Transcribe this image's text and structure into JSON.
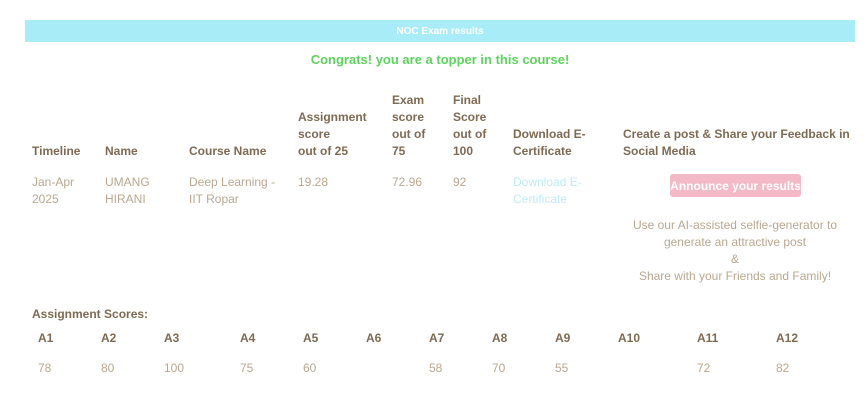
{
  "banner": {
    "title": "NOC Exam results"
  },
  "congrats": "Congrats! you are a topper in this course!",
  "table": {
    "headers": {
      "timeline": "Timeline",
      "name": "Name",
      "course": "Course Name",
      "assignment": [
        "Assignment",
        "score",
        "out of 25"
      ],
      "exam": [
        "Exam",
        "score",
        "out of",
        "75"
      ],
      "final": [
        "Final",
        "Score",
        "out of",
        "100"
      ],
      "download": [
        "Download E-",
        "Certificate"
      ],
      "share": [
        "Create a post & Share your Feedback in",
        "Social Media"
      ]
    },
    "row": {
      "timeline": [
        "Jan-Apr",
        "2025"
      ],
      "name": [
        "UMANG",
        "HIRANI"
      ],
      "course": [
        "Deep Learning -",
        "IIT Ropar"
      ],
      "assignment": "19.28",
      "exam": "72.96",
      "final": "92",
      "download": [
        "Download E-",
        "Certificate"
      ]
    }
  },
  "announce_button": "Announce your results",
  "promo": [
    "Use our AI-assisted selfie-generator to",
    "generate an attractive post",
    "&",
    "Share with your Friends and Family!"
  ],
  "assignment_scores": {
    "title": "Assignment Scores:",
    "items": [
      {
        "label": "A1",
        "score": "78"
      },
      {
        "label": "A2",
        "score": "80"
      },
      {
        "label": "A3",
        "score": "100"
      },
      {
        "label": "A4",
        "score": "75"
      },
      {
        "label": "A5",
        "score": "60"
      },
      {
        "label": "A6",
        "score": ""
      },
      {
        "label": "A7",
        "score": "58"
      },
      {
        "label": "A8",
        "score": "70"
      },
      {
        "label": "A9",
        "score": "55"
      },
      {
        "label": "A10",
        "score": ""
      },
      {
        "label": "A11",
        "score": "72"
      },
      {
        "label": "A12",
        "score": "82"
      }
    ]
  },
  "colors": {
    "banner": "#a8ecf8",
    "congrats": "#5bd45b",
    "button": "#f4b9c6",
    "link": "#bfeaf8"
  }
}
